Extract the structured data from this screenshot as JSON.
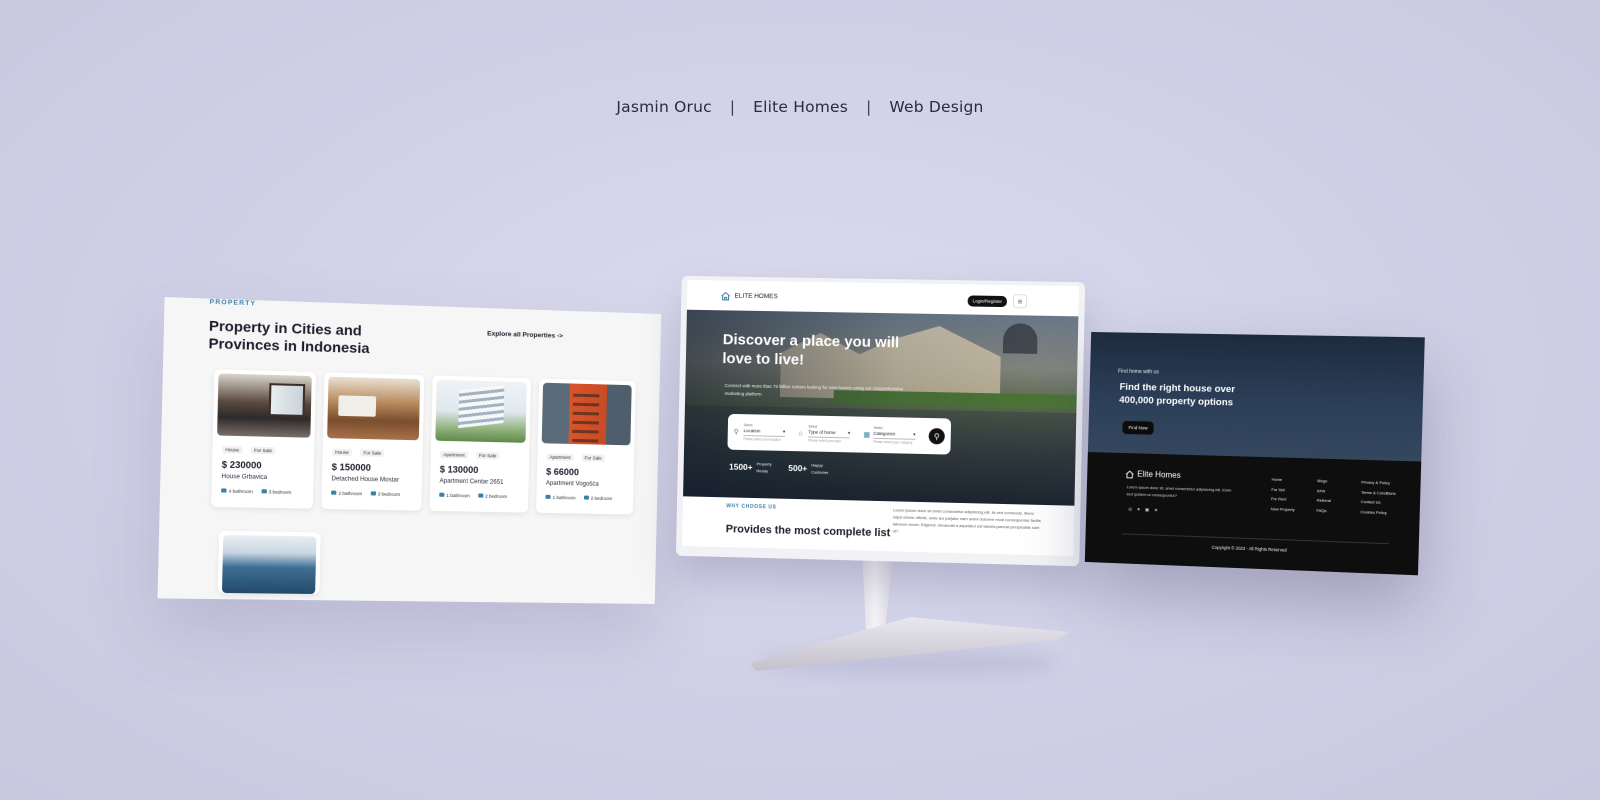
{
  "header": {
    "author": "Jasmin Oruc",
    "project": "Elite Homes",
    "category": "Web Design",
    "separator": "|"
  },
  "left_panel": {
    "eyebrow": "PROPERTY",
    "title": "Property in Cities and Provinces in Indonesia",
    "explore_link": "Explore all Properties ->",
    "cards": [
      {
        "type": "House",
        "status": "For Sale",
        "price": "$ 230000",
        "name": "House Grbavica",
        "bathroom": "4 bathroom",
        "bedroom": "3 bedroom"
      },
      {
        "type": "House",
        "status": "For Sale",
        "price": "$ 150000",
        "name": "Detached House Mostar",
        "bathroom": "2 bathroom",
        "bedroom": "3 bedroom"
      },
      {
        "type": "Apartment",
        "status": "For Sale",
        "price": "$ 130000",
        "name": "Apartment Centar 2651",
        "bathroom": "1 bathroom",
        "bedroom": "2 bedroom"
      },
      {
        "type": "Apartment",
        "status": "For Sale",
        "price": "$ 66000",
        "name": "Apartment Vogošća",
        "bathroom": "1 bathroom",
        "bedroom": "2 bedroom"
      }
    ]
  },
  "center_panel": {
    "logo_text": "ELITE HOMES",
    "login_button": "Login/Register",
    "menu_icon": "≡",
    "hero_title": "Discover a place you will love to live!",
    "hero_subtitle": "Connect with more than 75 billion renters looking for new homes using our comprehensive marketing platform.",
    "search": {
      "fields": [
        {
          "label": "Select",
          "value": "Location",
          "hint": "Please select your location"
        },
        {
          "label": "Select",
          "value": "Type of home",
          "hint": "Please select your type"
        },
        {
          "label": "Select",
          "value": "Categories",
          "hint": "Please select your category"
        }
      ]
    },
    "stats": [
      {
        "number": "1500+",
        "label": "Property Ready"
      },
      {
        "number": "500+",
        "label": "Happy Customer"
      }
    ],
    "why_eyebrow": "WHY CHOOSE US",
    "why_title": "Provides the most complete list",
    "why_text": "Lorem ipsum dolor sit amet consectetur adipisicing elit, iis sed commodo, libero iulpsi dolore officiis, unde leo parjatur nam animi dolorem modi consequentur facilis laborum rerum. Eligendi, obcaecati a aspetatur est laboris parurat perspiciatis sunt ut?"
  },
  "right_panel": {
    "cta_small": "Find home with us",
    "cta_title": "Find the right house over 400,000 property options",
    "cta_button": "Find Now",
    "brand": "Elite Homes",
    "description": "Lorem ipsum dolor sit, amet consectetur adipisicing elit. Enim sed quidem ut consequuntur?",
    "socials": [
      "◎",
      "♥",
      "▣",
      "➤"
    ],
    "col_a": [
      "Home",
      "For Sell",
      "For Rent",
      "New Property"
    ],
    "col_b": [
      "Blogs",
      "KPR",
      "Referral",
      "FAQs"
    ],
    "col_c": [
      "Privacy & Policy",
      "Terms & Conditions",
      "Contact Us",
      "Cookies Policy"
    ],
    "copyright": "Copyright © 2023 - All Rights Reserved"
  },
  "colors": {
    "accent": "#3c7fa8",
    "dark": "#111111",
    "background": "#d3d3e8"
  }
}
